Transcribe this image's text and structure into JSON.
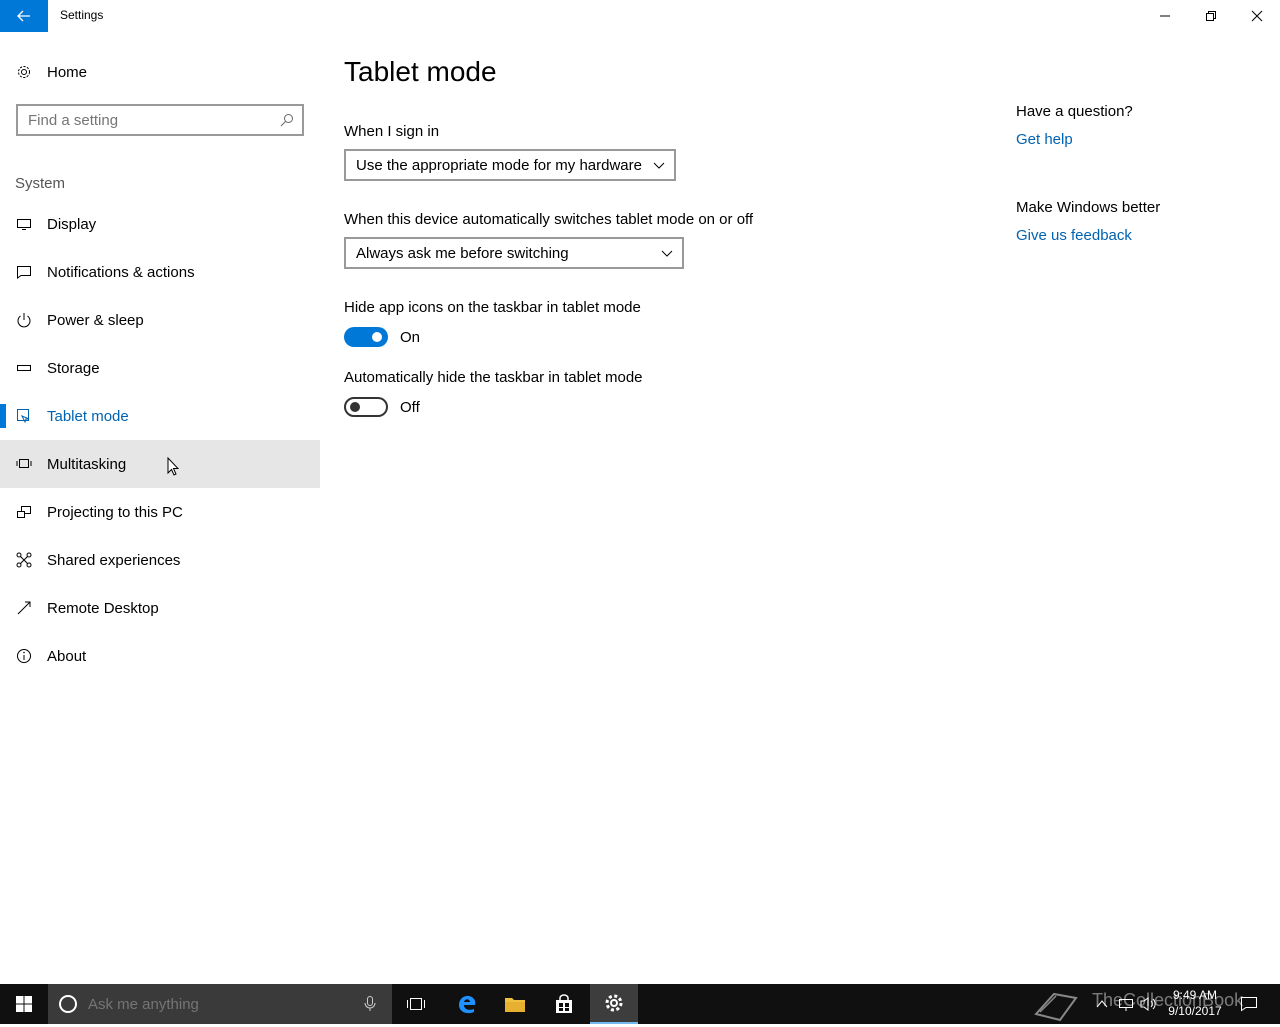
{
  "window": {
    "title": "Settings"
  },
  "sidebar": {
    "home_label": "Home",
    "search_placeholder": "Find a setting",
    "section": "System",
    "items": [
      {
        "label": "Display",
        "icon": "monitor-icon"
      },
      {
        "label": "Notifications & actions",
        "icon": "notification-icon"
      },
      {
        "label": "Power & sleep",
        "icon": "power-icon"
      },
      {
        "label": "Storage",
        "icon": "storage-icon"
      },
      {
        "label": "Tablet mode",
        "icon": "tablet-mode-icon",
        "active": true
      },
      {
        "label": "Multitasking",
        "icon": "multitasking-icon",
        "hover": true
      },
      {
        "label": "Projecting to this PC",
        "icon": "projecting-icon"
      },
      {
        "label": "Shared experiences",
        "icon": "shared-experiences-icon"
      },
      {
        "label": "Remote Desktop",
        "icon": "remote-desktop-icon"
      },
      {
        "label": "About",
        "icon": "info-icon"
      }
    ]
  },
  "main": {
    "title": "Tablet mode",
    "sign_in": {
      "label": "When I sign in",
      "value": "Use the appropriate mode for my hardware"
    },
    "switch": {
      "label": "When this device automatically switches tablet mode on or off",
      "value": "Always ask me before switching"
    },
    "hide_icons": {
      "label": "Hide app icons on the taskbar in tablet mode",
      "state": "On"
    },
    "hide_taskbar": {
      "label": "Automatically hide the taskbar in tablet mode",
      "state": "Off"
    }
  },
  "aside": {
    "question": "Have a question?",
    "get_help": "Get help",
    "better": "Make Windows better",
    "feedback": "Give us feedback"
  },
  "taskbar": {
    "search_placeholder": "Ask me anything",
    "time": "9:49 AM",
    "date": "9/10/2017",
    "watermark": "TheCollectionBook"
  },
  "colors": {
    "accent": "#0078d7",
    "link": "#0063b1",
    "taskbar": "#101010"
  }
}
